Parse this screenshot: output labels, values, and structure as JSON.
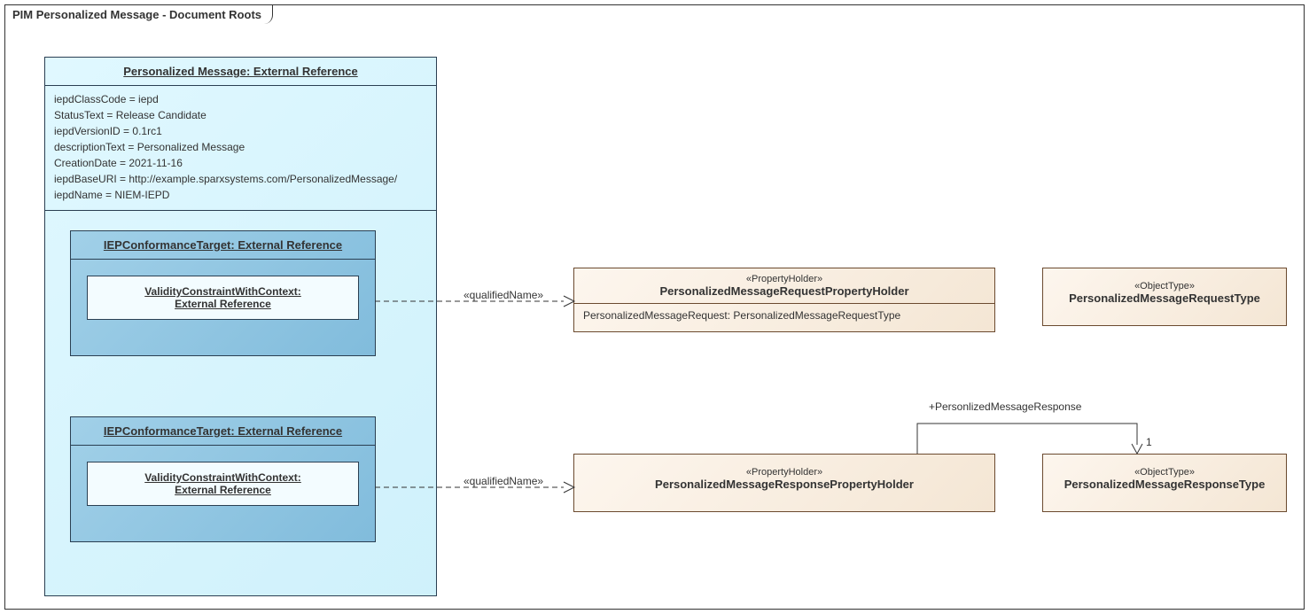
{
  "frame": {
    "title": "PIM Personalized Message - Document Roots"
  },
  "mainInstance": {
    "title": "Personalized Message: External Reference",
    "attrs": {
      "iepdClassCode": "iepdClassCode = iepd",
      "StatusText": "StatusText = Release Candidate",
      "iepdVersionID": "iepdVersionID = 0.1rc1",
      "descriptionText": "descriptionText = Personalized Message",
      "CreationDate": "CreationDate = 2021-11-16",
      "iepdBaseURI": "iepdBaseURI = http://example.sparxsystems.com/PersonalizedMessage/",
      "iepdName": "iepdName = NIEM-IEPD"
    }
  },
  "target1": {
    "title": "IEPConformanceTarget: External Reference",
    "validityLine1": "ValidityConstraintWithContext:",
    "validityLine2": "External Reference"
  },
  "target2": {
    "title": "IEPConformanceTarget: External Reference",
    "validityLine1": "ValidityConstraintWithContext:",
    "validityLine2": "External Reference"
  },
  "requestHolder": {
    "stereo": "«PropertyHolder»",
    "name": "PersonalizedMessageRequestPropertyHolder",
    "slot": "PersonalizedMessageRequest: PersonalizedMessageRequestType"
  },
  "requestType": {
    "stereo": "«ObjectType»",
    "name": "PersonalizedMessageRequestType"
  },
  "responseHolder": {
    "stereo": "«PropertyHolder»",
    "name": "PersonalizedMessageResponsePropertyHolder"
  },
  "responseType": {
    "stereo": "«ObjectType»",
    "name": "PersonalizedMessageResponseType"
  },
  "labels": {
    "qualifiedName": "«qualifiedName»",
    "assocRole": "+PersonlizedMessageResponse",
    "mult": "1"
  }
}
